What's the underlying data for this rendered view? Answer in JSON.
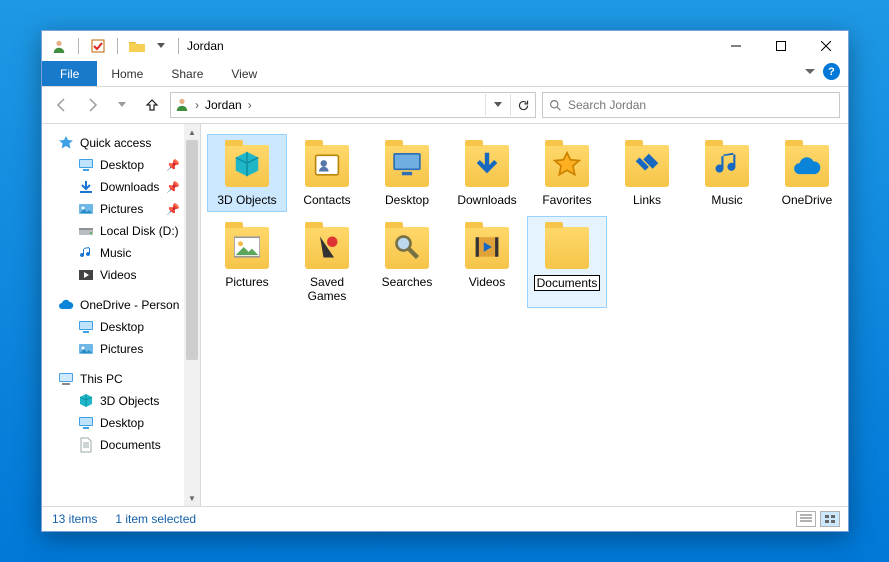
{
  "titlebar": {
    "title": "Jordan",
    "qat_icons": [
      "user-icon",
      "divider",
      "check-icon",
      "divider",
      "folder-icon",
      "caret-down-icon"
    ]
  },
  "window_controls": {
    "minimize": "–",
    "maximize": "□",
    "close": "✕"
  },
  "ribbon": {
    "tabs": [
      {
        "id": "file",
        "label": "File",
        "active": true
      },
      {
        "id": "home",
        "label": "Home"
      },
      {
        "id": "share",
        "label": "Share"
      },
      {
        "id": "view",
        "label": "View"
      }
    ]
  },
  "nav": {
    "back_enabled": false,
    "forward_enabled": false,
    "up_enabled": true,
    "address": {
      "crumbs": [
        "Jordan"
      ]
    },
    "refresh_label": "Refresh",
    "search_placeholder": "Search Jordan"
  },
  "tree": {
    "groups": [
      {
        "id": "quick_access",
        "icon": "star-blue",
        "label": "Quick access",
        "children": [
          {
            "id": "qa-desktop",
            "icon": "desktop",
            "label": "Desktop",
            "pinned": true
          },
          {
            "id": "qa-downloads",
            "icon": "download-blue",
            "label": "Downloads",
            "pinned": true
          },
          {
            "id": "qa-pictures",
            "icon": "pictures",
            "label": "Pictures",
            "pinned": true
          },
          {
            "id": "qa-d",
            "icon": "drive",
            "label": "Local Disk (D:)"
          },
          {
            "id": "qa-music",
            "icon": "music",
            "label": "Music"
          },
          {
            "id": "qa-videos",
            "icon": "videos",
            "label": "Videos"
          }
        ]
      },
      {
        "id": "onedrive",
        "icon": "cloud-blue",
        "label": "OneDrive - Person",
        "children": [
          {
            "id": "od-desktop",
            "icon": "desktop",
            "label": "Desktop"
          },
          {
            "id": "od-pictures",
            "icon": "pictures",
            "label": "Pictures"
          }
        ]
      },
      {
        "id": "this_pc",
        "icon": "pc",
        "label": "This PC",
        "children": [
          {
            "id": "pc-3d",
            "icon": "cube",
            "label": "3D Objects"
          },
          {
            "id": "pc-desktop",
            "icon": "desktop",
            "label": "Desktop"
          },
          {
            "id": "pc-documents",
            "icon": "document",
            "label": "Documents"
          }
        ]
      }
    ]
  },
  "items": [
    {
      "id": "3d-objects",
      "label": "3D Objects",
      "icon": "cube",
      "state": "selected"
    },
    {
      "id": "contacts",
      "label": "Contacts",
      "icon": "contact"
    },
    {
      "id": "desktop",
      "label": "Desktop",
      "icon": "desktop-big"
    },
    {
      "id": "downloads",
      "label": "Downloads",
      "icon": "download-big",
      "wrap": "Downlo\nads"
    },
    {
      "id": "favorites",
      "label": "Favorites",
      "icon": "star"
    },
    {
      "id": "links",
      "label": "Links",
      "icon": "link"
    },
    {
      "id": "music",
      "label": "Music",
      "icon": "music-big"
    },
    {
      "id": "onedrive",
      "label": "OneDrive",
      "icon": "cloud"
    },
    {
      "id": "pictures",
      "label": "Pictures",
      "icon": "picture"
    },
    {
      "id": "saved-games",
      "label": "Saved Games",
      "icon": "games",
      "wrap": "Saved\nGames"
    },
    {
      "id": "searches",
      "label": "Searches",
      "icon": "search-big"
    },
    {
      "id": "videos",
      "label": "Videos",
      "icon": "video"
    },
    {
      "id": "documents",
      "label": "Documents",
      "icon": "folder",
      "state": "renaming",
      "rename_value": "Documents"
    }
  ],
  "status": {
    "count_label": "13 items",
    "selection_label": "1 item selected"
  }
}
